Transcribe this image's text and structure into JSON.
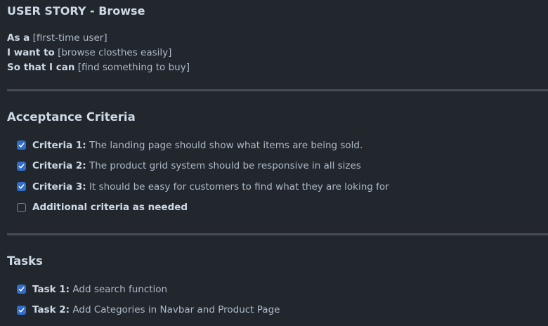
{
  "title": "USER STORY - Browse",
  "story": {
    "as_a_label": "As a",
    "as_a_value": "[first-time user]",
    "i_want_label": "I want to",
    "i_want_value": "[browse closthes easily]",
    "so_that_label": "So that I can",
    "so_that_value": "[find something to buy]"
  },
  "acceptance": {
    "heading": "Acceptance Criteria",
    "items": [
      {
        "label": "Criteria 1:",
        "text": "The landing page should show what items are being sold.",
        "checked": true
      },
      {
        "label": "Criteria 2:",
        "text": "The product grid system should be responsive in all sizes",
        "checked": true
      },
      {
        "label": "Criteria 3:",
        "text": "It should be easy for customers to find what they are loking for",
        "checked": true
      },
      {
        "label": "Additional criteria as needed",
        "text": "",
        "checked": false
      }
    ]
  },
  "tasks": {
    "heading": "Tasks",
    "items": [
      {
        "label": "Task 1:",
        "text": "Add search function",
        "checked": true
      },
      {
        "label": "Task 2:",
        "text": "Add Categories in Navbar and Product Page",
        "checked": true
      }
    ]
  },
  "colors": {
    "background": "#22272e",
    "checkbox_accent": "#316dca",
    "text": "#adbac7",
    "heading": "#cdd9e5",
    "divider": "#444c56"
  }
}
